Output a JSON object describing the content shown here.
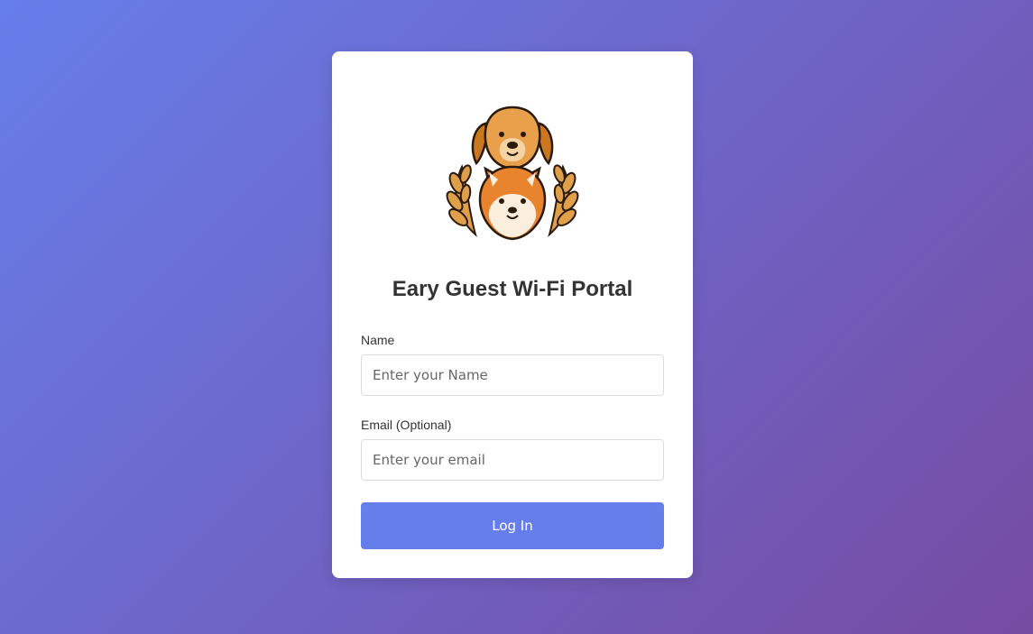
{
  "portal": {
    "title": "Eary Guest Wi-Fi Portal"
  },
  "form": {
    "name_label": "Name",
    "name_placeholder": "Enter your Name",
    "name_value": "",
    "email_label": "Email (Optional)",
    "email_placeholder": "Enter your email",
    "email_value": "",
    "login_label": "Log In"
  },
  "colors": {
    "background_start": "#667eea",
    "background_end": "#764ba2",
    "button": "#667eea",
    "card": "#ffffff"
  },
  "logo": {
    "icon": "dog-mascot-logo"
  }
}
